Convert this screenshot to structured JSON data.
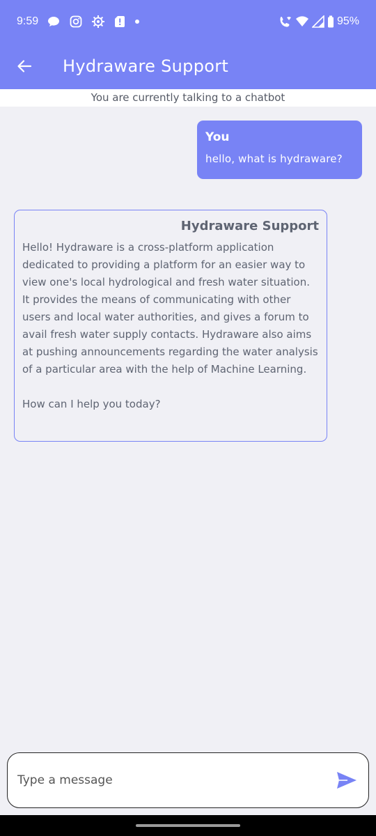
{
  "status_bar": {
    "time": "9:59",
    "battery": "95%",
    "icons_left": [
      "chat-bubble-icon",
      "instagram-icon",
      "settings-gear-icon",
      "notification-alert-icon",
      "dot-icon"
    ],
    "icons_right": [
      "wifi-calling-icon",
      "wifi-icon",
      "signal-icon",
      "battery-icon"
    ]
  },
  "app_bar": {
    "title": "Hydraware Support",
    "back_icon": "arrow-left-icon"
  },
  "banner": {
    "text": "You are currently talking to a chatbot"
  },
  "messages": [
    {
      "sender": "You",
      "text": "hello, what is hydraware?"
    },
    {
      "sender": "Hydraware Support",
      "text": "Hello! Hydraware is a cross-platform application dedicated to providing a platform for an easier way to view one's local hydrological and fresh water situation. It provides the means of communicating with other users and local water authorities, and gives a forum to avail fresh water supply contacts. Hydraware also aims at pushing announcements regarding the water analysis of a particular area with the help of Machine Learning.\n\nHow can I help you today?"
    }
  ],
  "composer": {
    "placeholder": "Type a message",
    "value": "",
    "send_icon": "send-icon"
  },
  "colors": {
    "accent": "#7883f5",
    "background": "#f0f0f5",
    "text": "#5e6472"
  }
}
